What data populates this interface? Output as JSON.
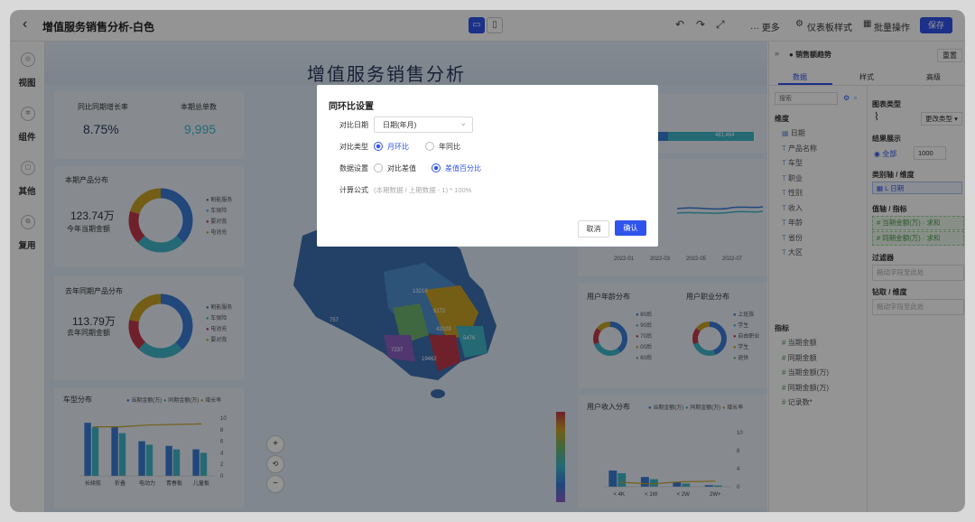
{
  "topbar": {
    "title": "增值服务销售分析-白色",
    "more": "··· 更多",
    "dashboard_style": "仪表板样式",
    "batch_ops": "批量操作",
    "save": "保存"
  },
  "leftnav": {
    "items": [
      "视图",
      "组件",
      "其他",
      "复用"
    ]
  },
  "dashboard": {
    "title": "增值服务销售分析",
    "kpi": {
      "label1": "同比同期增长率",
      "value1": "8.75%",
      "label2": "本期总单数",
      "value2": "9,995"
    },
    "current_products": {
      "title": "本期产品分布",
      "amount": "123.74万",
      "caption": "今年当期金额",
      "legend": [
        "割能服务",
        "车保险",
        "要对我",
        "电池充"
      ]
    },
    "last_products": {
      "title": "去年同期产品分布",
      "amount": "113.79万",
      "caption": "去年同期金额",
      "legend": [
        "割能服务",
        "车保险",
        "电池充",
        "要对我"
      ]
    },
    "car_types": {
      "title": "车型分布",
      "legend": [
        "当期金额(万)",
        "同期金额(万)",
        "增长率"
      ],
      "categories": [
        "长续航",
        "折叠",
        "电动力",
        "青春板",
        "儿童板"
      ],
      "y2_ticks": [
        "10",
        "8",
        "6",
        "4",
        "2",
        "0"
      ]
    },
    "bar_value": "481,464",
    "trend_dates": [
      "2022-01",
      "2022-03",
      "2022-05",
      "2022-07"
    ],
    "age_title": "用户年龄分布",
    "age_legend": [
      "80后",
      "90后",
      "70后",
      "00后",
      "60后"
    ],
    "job_title": "用户职业分布",
    "job_legend": [
      "上班族",
      "学生",
      "自由职业",
      "学生",
      "退休"
    ],
    "income": {
      "title": "用户收入分布",
      "legend": [
        "当期金额(万)",
        "同期金额(万)",
        "增长率"
      ],
      "categories": [
        "< 4K",
        "< 1W",
        "< 2W",
        "2W+"
      ],
      "y_ticks": [
        "10",
        "8",
        "4",
        "0"
      ]
    },
    "map_labels": [
      "757",
      "13210",
      "5172",
      "42029",
      "5476",
      "7237",
      "19462"
    ],
    "zoom": {
      "plus": "+",
      "reset": "⟲",
      "minus": "−"
    }
  },
  "modal": {
    "title": "同环比设置",
    "compare_date_label": "对比日期",
    "compare_date_value": "日期(年月)",
    "compare_type_label": "对比类型",
    "type_options": [
      "月环比",
      "年同比"
    ],
    "data_setting_label": "数据设置",
    "data_options": [
      "对比差值",
      "差值百分比"
    ],
    "formula_label": "计算公式",
    "formula_value": "(本期数据 / 上期数据 - 1) * 100%",
    "cancel": "取消",
    "ok": "确认"
  },
  "rightpanel": {
    "header": "销售额趋势",
    "reset": "重置",
    "tabs": [
      "数据",
      "样式",
      "高级"
    ],
    "search_placeholder": "搜索",
    "dim_title": "维度",
    "dims": [
      "日期",
      "产品名称",
      "车型",
      "职业",
      "性别",
      "收入",
      "年龄",
      "省份",
      "大区"
    ],
    "measure_title": "指标",
    "measures": [
      "当期金额",
      "同期金额",
      "当期金额(万)",
      "同期金额(万)",
      "记录数*"
    ],
    "chart_type_label": "图表类型",
    "change_type": "更改类型",
    "result_label": "结果展示",
    "result_all": "全部",
    "result_num": "1000",
    "category_label": "类别轴 / 维度",
    "category_value": "L 日期",
    "value_label": "值轴 / 指标",
    "value_items": [
      "当期金额(万)",
      "同期金额(万)"
    ],
    "sum_label": "求和",
    "filter_label": "过滤器",
    "filter_placeholder": "拖动字段至此处",
    "drill_label": "钻取 / 维度",
    "drill_placeholder": "拖动字段至此处"
  },
  "colors": {
    "accent": "#2f54eb",
    "blue": "#3a7bd5",
    "teal": "#3fb6c8",
    "crimson": "#c0394b",
    "gold": "#c9a227"
  },
  "chart_data": [
    {
      "type": "bar",
      "title": "车型分布",
      "categories": [
        "长续航",
        "折叠",
        "电动力",
        "青春板",
        "儿童板"
      ],
      "series": [
        {
          "name": "当期金额(万)",
          "values": [
            9.2,
            8.6,
            6.0,
            5.2,
            4.6
          ]
        },
        {
          "name": "同期金额(万)",
          "values": [
            8.4,
            7.4,
            5.4,
            4.6,
            4.0
          ]
        },
        {
          "name": "增长率",
          "values": [
            8.5,
            8.5,
            8.8,
            8.9,
            9.0
          ]
        }
      ],
      "ylim": [
        0,
        10
      ]
    },
    {
      "type": "bar",
      "title": "用户收入分布",
      "categories": [
        "< 4K",
        "< 1W",
        "< 2W",
        "2W+"
      ],
      "series": [
        {
          "name": "当期金额(万)",
          "values": [
            3.0,
            1.8,
            0.8,
            0.3
          ]
        },
        {
          "name": "同期金额(万)",
          "values": [
            2.5,
            1.4,
            0.6,
            0.25
          ]
        },
        {
          "name": "增长率",
          "values": [
            7.5,
            7.2,
            7.6,
            7.7
          ]
        }
      ],
      "ylim": [
        0,
        10
      ]
    }
  ]
}
